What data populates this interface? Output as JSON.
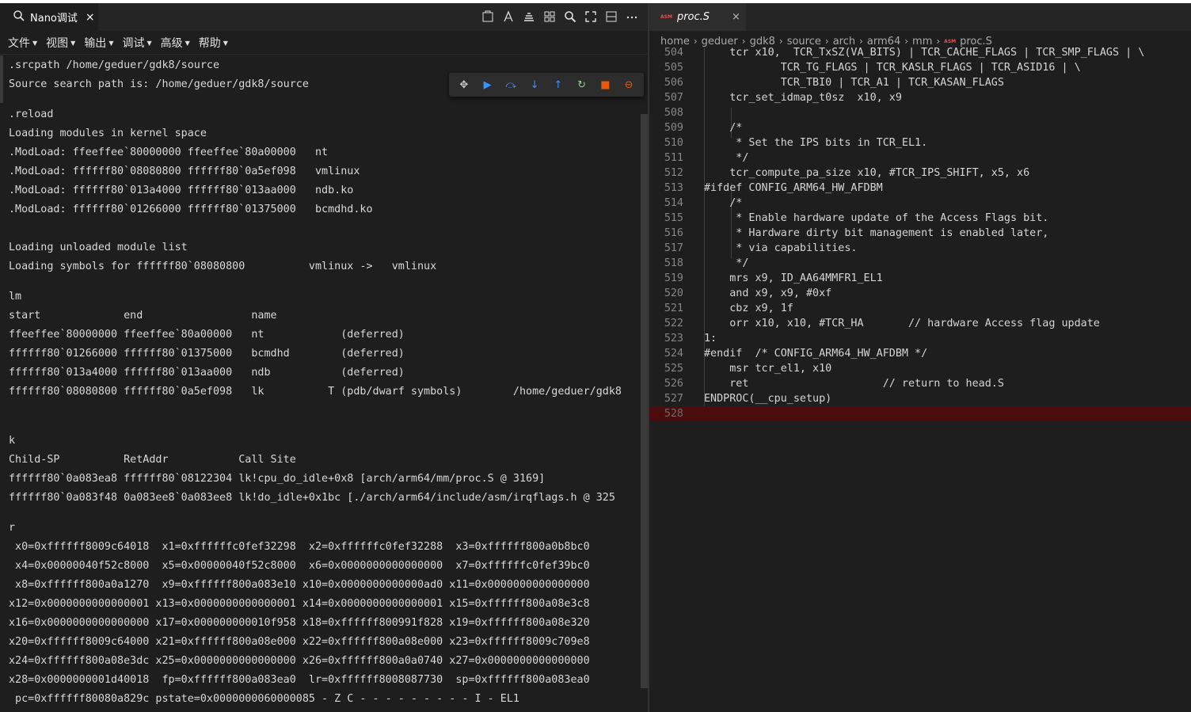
{
  "left": {
    "tab_title": "Nano调试",
    "tab_close": "×",
    "menu": [
      "文件",
      "视图",
      "输出",
      "调试",
      "高级",
      "帮助"
    ],
    "console_lines": [
      ".srcpath /home/geduer/gdk8/source",
      "Source search path is: /home/geduer/gdk8/source",
      "",
      ".reload",
      "Loading modules in kernel space",
      ".ModLoad: ffeeffee`80000000 ffeeffee`80a00000   nt",
      ".ModLoad: ffffff80`08080800 ffffff80`0a5ef098   vmlinux",
      ".ModLoad: ffffff80`013a4000 ffffff80`013aa000   ndb.ko",
      ".ModLoad: ffffff80`01266000 ffffff80`01375000   bcmdhd.ko",
      "",
      "Loading unloaded module list",
      "Loading symbols for ffffff80`08080800          vmlinux ->   vmlinux",
      "",
      "lm",
      "start             end                 name",
      "ffeeffee`80000000 ffeeffee`80a00000   nt            (deferred)",
      "ffffff80`01266000 ffffff80`01375000   bcmdhd        (deferred)",
      "ffffff80`013a4000 ffffff80`013aa000   ndb           (deferred)",
      "ffffff80`08080800 ffffff80`0a5ef098   lk          T (pdb/dwarf symbols)        /home/geduer/gdk8",
      "",
      "",
      "k",
      "Child-SP          RetAddr           Call Site",
      "ffffff80`0a083ea8 ffffff80`08122304 lk!cpu_do_idle+0x8 [arch/arm64/mm/proc.S @ 3169]",
      "ffffff80`0a083f48 0a083ee8`0a083ee8 lk!do_idle+0x1bc [./arch/arm64/include/asm/irqflags.h @ 325",
      "",
      "r",
      " x0=0xffffff8009c64018  x1=0xffffffc0fef32298  x2=0xffffffc0fef32288  x3=0xffffff800a0b8bc0",
      " x4=0x00000040f52c8000  x5=0x00000040f52c8000  x6=0x0000000000000000  x7=0xffffffc0fef39bc0",
      " x8=0xffffff800a0a1270  x9=0xffffff800a083e10 x10=0x0000000000000ad0 x11=0x0000000000000000",
      "x12=0x0000000000000001 x13=0x0000000000000001 x14=0x0000000000000001 x15=0xffffff800a08e3c8",
      "x16=0x0000000000000000 x17=0x000000000010f958 x18=0xffffff800991f828 x19=0xffffff800a08e320",
      "x20=0xffffff8009c64000 x21=0xffffff800a08e000 x22=0xffffff800a08e000 x23=0xffffff8009c709e8",
      "x24=0xffffff800a08e3dc x25=0x0000000000000000 x26=0xffffff800a0a0740 x27=0x0000000000000000",
      "x28=0x0000000001d40018  fp=0xffffff800a083ea0  lr=0xffffff8008087730  sp=0xffffff800a083ea0",
      " pc=0xffffff80080a829c pstate=0x0000000060000085 - Z C - - - - - - - - - I - EL1"
    ]
  },
  "right": {
    "tab_title": "proc.S",
    "tab_badge": "ASM",
    "tab_close": "×",
    "breadcrumb": [
      "home",
      "geduer",
      "gdk8",
      "source",
      "arch",
      "arm64",
      "mm",
      "proc.S"
    ],
    "code_lines": [
      {
        "n": "504",
        "t": "    tcr x10,  TCR_TxSZ(VA_BITS) | TCR_CACHE_FLAGS | TCR_SMP_FLAGS | \\"
      },
      {
        "n": "505",
        "t": "            TCR_TG_FLAGS | TCR_KASLR_FLAGS | TCR_ASID16 | \\"
      },
      {
        "n": "506",
        "t": "            TCR_TBI0 | TCR_A1 | TCR_KASAN_FLAGS"
      },
      {
        "n": "507",
        "t": "    tcr_set_idmap_t0sz  x10, x9"
      },
      {
        "n": "508",
        "t": ""
      },
      {
        "n": "509",
        "t": "    /*"
      },
      {
        "n": "510",
        "t": "     * Set the IPS bits in TCR_EL1."
      },
      {
        "n": "511",
        "t": "     */"
      },
      {
        "n": "512",
        "t": "    tcr_compute_pa_size x10, #TCR_IPS_SHIFT, x5, x6"
      },
      {
        "n": "513",
        "t": "#ifdef CONFIG_ARM64_HW_AFDBM"
      },
      {
        "n": "514",
        "t": "    /*"
      },
      {
        "n": "515",
        "t": "     * Enable hardware update of the Access Flags bit."
      },
      {
        "n": "516",
        "t": "     * Hardware dirty bit management is enabled later,"
      },
      {
        "n": "517",
        "t": "     * via capabilities."
      },
      {
        "n": "518",
        "t": "     */"
      },
      {
        "n": "519",
        "t": "    mrs x9, ID_AA64MMFR1_EL1"
      },
      {
        "n": "520",
        "t": "    and x9, x9, #0xf"
      },
      {
        "n": "521",
        "t": "    cbz x9, 1f"
      },
      {
        "n": "522",
        "t": "    orr x10, x10, #TCR_HA       // hardware Access flag update"
      },
      {
        "n": "523",
        "t": "1:"
      },
      {
        "n": "524",
        "t": "#endif  /* CONFIG_ARM64_HW_AFDBM */"
      },
      {
        "n": "525",
        "t": "    msr tcr_el1, x10"
      },
      {
        "n": "526",
        "t": "    ret                     // return to head.S"
      },
      {
        "n": "527",
        "t": "ENDPROC(__cpu_setup)"
      },
      {
        "n": "528",
        "t": ""
      }
    ],
    "highlight_line": "528"
  },
  "colors": {
    "bg": "#1e1e1e",
    "tabbar": "#252526",
    "debug_blue": "#3794ff",
    "debug_green": "#89d185",
    "debug_orange": "#e8590c",
    "highlight": "#4a0c0c"
  }
}
